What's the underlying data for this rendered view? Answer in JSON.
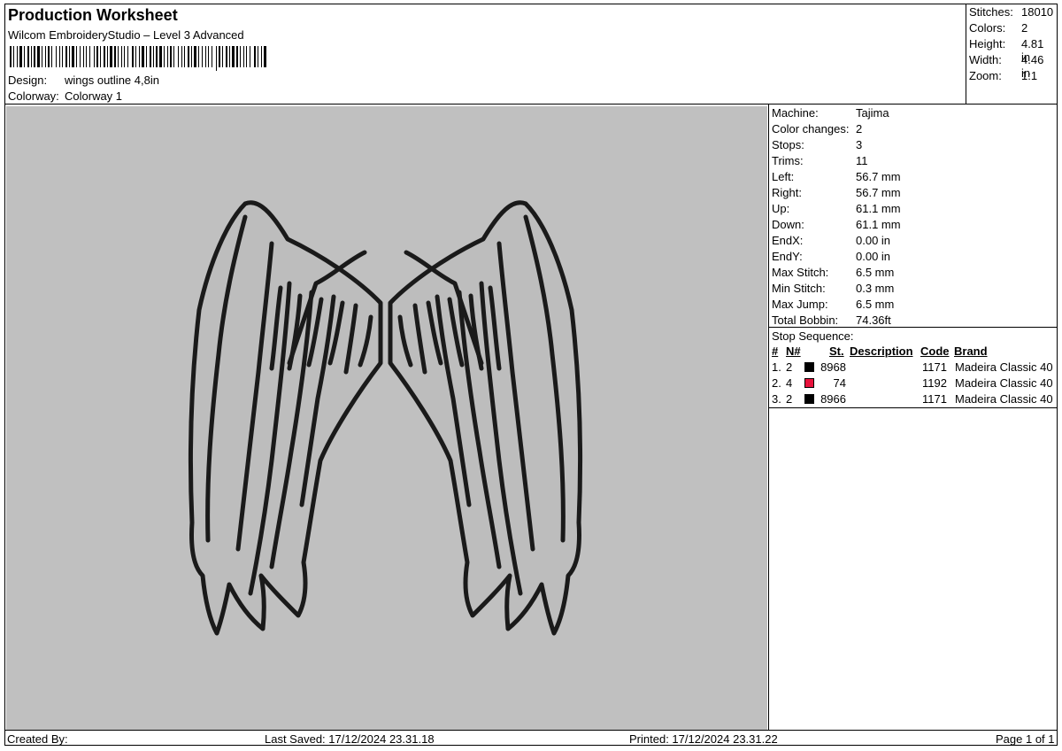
{
  "header": {
    "title": "Production Worksheet",
    "software": "Wilcom EmbroideryStudio – Level 3 Advanced",
    "design_label": "Design:",
    "design_value": "wings outline 4,8in",
    "colorway_label": "Colorway:",
    "colorway_value": "Colorway 1"
  },
  "summary": {
    "stitches_label": "Stitches:",
    "stitches": "18010",
    "colors_label": "Colors:",
    "colors": "2",
    "height_label": "Height:",
    "height": "4.81 in",
    "width_label": "Width:",
    "width": "4.46 in",
    "zoom_label": "Zoom:",
    "zoom": "1:1"
  },
  "machine_info": [
    {
      "label": "Machine:",
      "value": "Tajima"
    },
    {
      "label": "Color changes:",
      "value": "2"
    },
    {
      "label": "Stops:",
      "value": "3"
    },
    {
      "label": "Trims:",
      "value": "11"
    },
    {
      "label": "Left:",
      "value": "56.7 mm"
    },
    {
      "label": "Right:",
      "value": "56.7 mm"
    },
    {
      "label": "Up:",
      "value": "61.1 mm"
    },
    {
      "label": "Down:",
      "value": "61.1 mm"
    },
    {
      "label": "EndX:",
      "value": "0.00 in"
    },
    {
      "label": "EndY:",
      "value": "0.00 in"
    },
    {
      "label": "Max Stitch:",
      "value": "6.5 mm"
    },
    {
      "label": "Min Stitch:",
      "value": "0.3 mm"
    },
    {
      "label": "Max Jump:",
      "value": "6.5 mm"
    },
    {
      "label": "Total Bobbin:",
      "value": "74.36ft"
    }
  ],
  "stop_sequence": {
    "title": "Stop Sequence:",
    "headers": {
      "num": "#",
      "n": "N#",
      "st": "St.",
      "description": "Description",
      "code": "Code",
      "brand": "Brand"
    },
    "rows": [
      {
        "num": "1.",
        "n": "2",
        "color": "#000000",
        "st": "8968",
        "code": "1171",
        "brand": "Madeira Classic 40"
      },
      {
        "num": "2.",
        "n": "4",
        "color": "#e8123c",
        "st": "74",
        "code": "1192",
        "brand": "Madeira Classic 40"
      },
      {
        "num": "3.",
        "n": "2",
        "color": "#000000",
        "st": "8966",
        "code": "1171",
        "brand": "Madeira Classic 40"
      }
    ]
  },
  "footer": {
    "created_by": "Created By:",
    "last_saved": "Last Saved: 17/12/2024 23.31.18",
    "printed": "Printed: 17/12/2024 23.31.22",
    "page": "Page 1 of 1"
  },
  "colors": {
    "preview_background": "#c0c0c0",
    "stitch_outline": "#1a1a1a",
    "stitch_fill": "#bdbdbd"
  },
  "icons": {
    "barcode": "barcode-graphic",
    "design_preview": "angel-wings-outline"
  }
}
